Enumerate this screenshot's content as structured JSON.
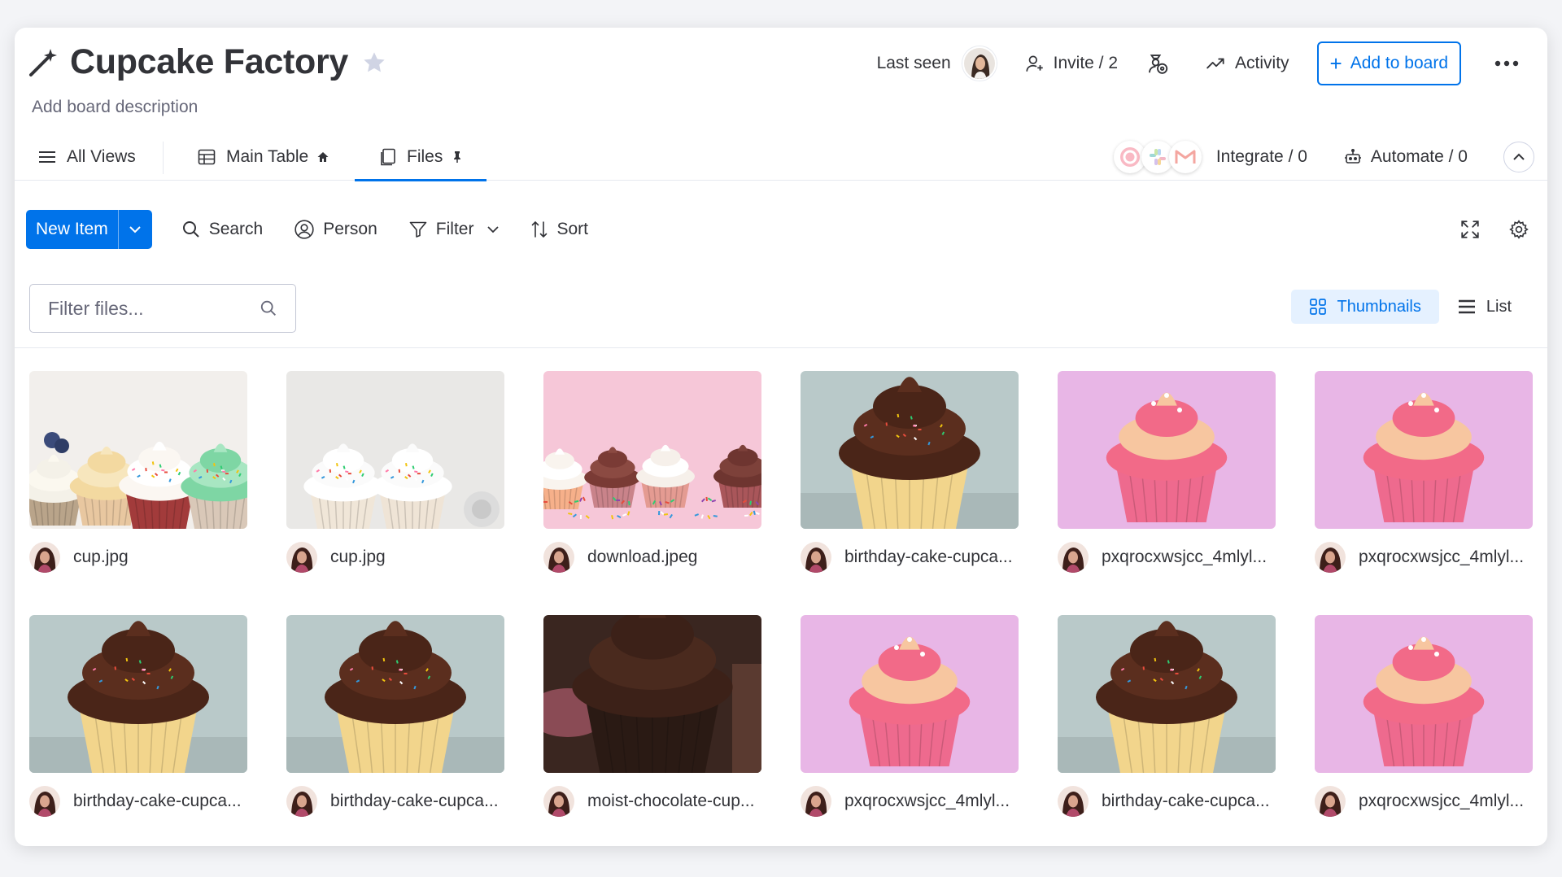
{
  "board": {
    "title": "Cupcake Factory",
    "description": "Add board description"
  },
  "header": {
    "last_seen": "Last seen",
    "invite": "Invite / 2",
    "activity": "Activity",
    "add_to_board": "Add to board"
  },
  "tabs": {
    "all_views": "All Views",
    "main_table": "Main Table",
    "files": "Files",
    "integrate": "Integrate / 0",
    "automate": "Automate / 0"
  },
  "toolbar": {
    "new_item": "New Item",
    "search": "Search",
    "person": "Person",
    "filter": "Filter",
    "sort": "Sort"
  },
  "files_view": {
    "filter_placeholder": "Filter files...",
    "thumbnails": "Thumbnails",
    "list": "List"
  },
  "colors": {
    "primary": "#0073ea",
    "active_bg": "#e5f1ff",
    "text": "#323338",
    "secondary_text": "#676879"
  },
  "files": [
    {
      "name": "cup.jpg",
      "image": "cupcake-row-assorted"
    },
    {
      "name": "cup.jpg",
      "image": "cupcakes-sprinkles-grey"
    },
    {
      "name": "download.jpeg",
      "image": "cupcakes-pink-sprinkles"
    },
    {
      "name": "birthday-cake-cupca...",
      "image": "chocolate-frosting-cupcake"
    },
    {
      "name": "pxqrocxwsjcc_4mlyl...",
      "image": "pink-frosting-cupcake"
    },
    {
      "name": "pxqrocxwsjcc_4mlyl...",
      "image": "pink-frosting-cupcake"
    },
    {
      "name": "birthday-cake-cupca...",
      "image": "chocolate-frosting-cupcake"
    },
    {
      "name": "birthday-cake-cupca...",
      "image": "chocolate-frosting-cupcake"
    },
    {
      "name": "moist-chocolate-cup...",
      "image": "dark-chocolate-cupcake"
    },
    {
      "name": "pxqrocxwsjcc_4mlyl...",
      "image": "pink-frosting-cupcake"
    },
    {
      "name": "birthday-cake-cupca...",
      "image": "chocolate-frosting-cupcake"
    },
    {
      "name": "pxqrocxwsjcc_4mlyl...",
      "image": "pink-frosting-cupcake"
    }
  ]
}
